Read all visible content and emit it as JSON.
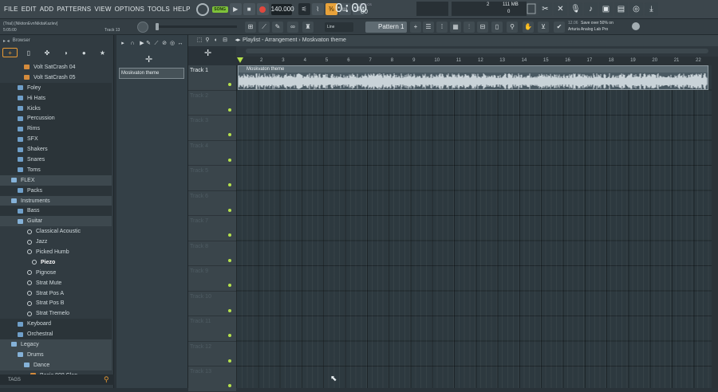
{
  "menu": [
    "FILE",
    "EDIT",
    "ADD",
    "PATTERNS",
    "VIEW",
    "OPTIONS",
    "TOOLS",
    "HELP"
  ],
  "transport": {
    "song_label": "SONG",
    "tempo": "140.000",
    "time": "0:00",
    "time_unit": "M:S:CS",
    "time_sub": "00"
  },
  "monitor": {
    "voices": "2",
    "memory": "111 MB",
    "cpu": "0"
  },
  "info": {
    "trial": "(Trial) [NikitonEvnNikitaKazlev]",
    "time": "5:05:00",
    "hint_track": "Track 13"
  },
  "snap": "Line",
  "pattern": "Pattern 1",
  "hint": {
    "number": "12.06",
    "line1": "Save over 50% on",
    "line2": "Arturia Analog Lab Pro"
  },
  "browser": {
    "title": "Browser",
    "tags_label": "TAGS",
    "tree": [
      {
        "label": "Volt SatCrash 04",
        "type": "sample",
        "indent": 30
      },
      {
        "label": "Volt SatCrash 05",
        "type": "sample",
        "indent": 30
      },
      {
        "label": "Foley",
        "type": "folder",
        "indent": 22
      },
      {
        "label": "Hi Hats",
        "type": "folder",
        "indent": 22
      },
      {
        "label": "Kicks",
        "type": "folder",
        "indent": 22
      },
      {
        "label": "Percussion",
        "type": "folder",
        "indent": 22
      },
      {
        "label": "Rims",
        "type": "folder",
        "indent": 22
      },
      {
        "label": "SFX",
        "type": "folder",
        "indent": 22
      },
      {
        "label": "Shakers",
        "type": "folder",
        "indent": 22
      },
      {
        "label": "Snares",
        "type": "folder",
        "indent": 22
      },
      {
        "label": "Toms",
        "type": "folder",
        "indent": 22
      },
      {
        "label": "FLEX",
        "type": "folder-open",
        "indent": 14
      },
      {
        "label": "Packs",
        "type": "folder",
        "indent": 22
      },
      {
        "label": "Instruments",
        "type": "folder-open",
        "indent": 14
      },
      {
        "label": "Bass",
        "type": "folder",
        "indent": 22
      },
      {
        "label": "Guitar",
        "type": "folder-open",
        "indent": 22
      },
      {
        "label": "Classical Acoustic",
        "type": "gear",
        "indent": 34
      },
      {
        "label": "Jazz",
        "type": "gear",
        "indent": 34
      },
      {
        "label": "Picked Humb",
        "type": "gear",
        "indent": 34
      },
      {
        "label": "Piezo",
        "type": "gear",
        "indent": 40,
        "selected": true
      },
      {
        "label": "Pignose",
        "type": "gear",
        "indent": 34
      },
      {
        "label": "Strat Mute",
        "type": "gear",
        "indent": 34
      },
      {
        "label": "Strat Pos A",
        "type": "gear",
        "indent": 34
      },
      {
        "label": "Strat Pos B",
        "type": "gear",
        "indent": 34
      },
      {
        "label": "Strat Tremelo",
        "type": "gear",
        "indent": 34
      },
      {
        "label": "Keyboard",
        "type": "folder",
        "indent": 22
      },
      {
        "label": "Orchestral",
        "type": "folder",
        "indent": 22
      },
      {
        "label": "Legacy",
        "type": "folder-open",
        "indent": 14
      },
      {
        "label": "Drums",
        "type": "folder-open",
        "indent": 22
      },
      {
        "label": "Dance",
        "type": "folder-open",
        "indent": 30
      },
      {
        "label": "Basic 808 Clap",
        "type": "sample",
        "indent": 38
      }
    ]
  },
  "picker": {
    "item": "Moskvaton theme"
  },
  "playlist": {
    "title": "Playlist - Arrangement › Moskvaton theme",
    "bars": [
      "2",
      "3",
      "4",
      "5",
      "6",
      "7",
      "8",
      "9",
      "10",
      "11",
      "12",
      "13",
      "14",
      "15",
      "16",
      "17",
      "18",
      "19",
      "20",
      "21",
      "22"
    ],
    "tracks": [
      "Track 1",
      "Track 2",
      "Track 3",
      "Track 4",
      "Track 5",
      "Track 6",
      "Track 7",
      "Track 8",
      "Track 9",
      "Track 10",
      "Track 11",
      "Track 12",
      "Track 13"
    ],
    "clip": {
      "name": "Moskvaton theme"
    }
  }
}
